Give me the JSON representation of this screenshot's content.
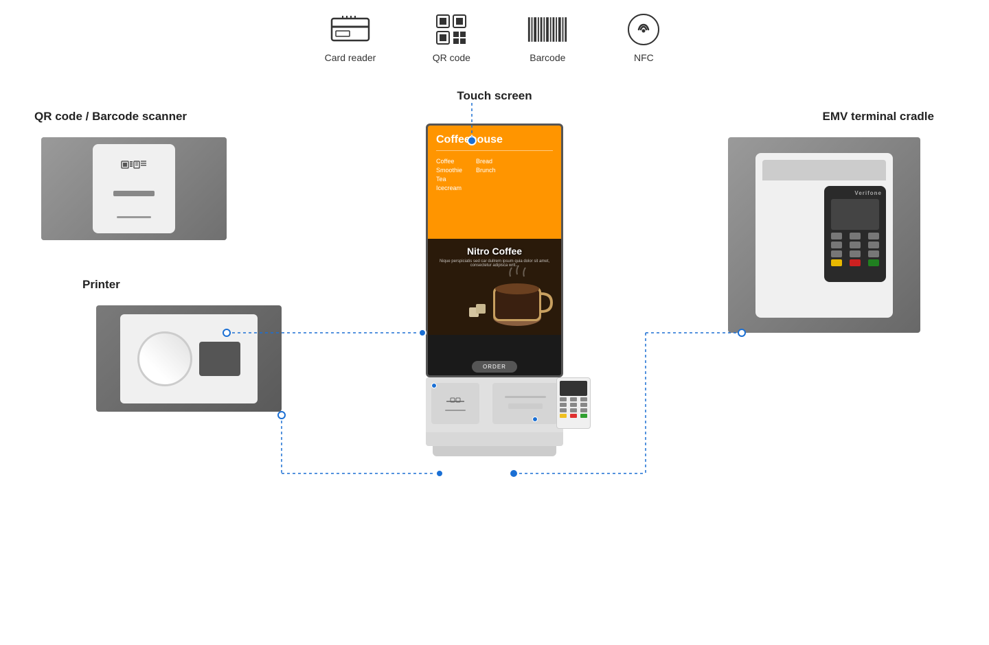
{
  "topIcons": {
    "items": [
      {
        "id": "card-reader",
        "label": "Card reader",
        "icon": "card-reader-icon"
      },
      {
        "id": "qr-code",
        "label": "QR code",
        "icon": "qr-code-icon"
      },
      {
        "id": "barcode",
        "label": "Barcode",
        "icon": "barcode-icon"
      },
      {
        "id": "nfc",
        "label": "NFC",
        "icon": "nfc-icon"
      }
    ]
  },
  "labels": {
    "touchScreen": "Touch screen",
    "qrBarcodeScanner": "QR code / Barcode scanner",
    "printer": "Printer",
    "emvTerminal": "EMV terminal cradle"
  },
  "screen": {
    "appName": "Coffeehouse",
    "menuItems": [
      {
        "left": [
          "Coffee",
          "Smoothie",
          "Tea",
          "Icecream"
        ]
      },
      {
        "right": [
          "Bread",
          "Brunch"
        ]
      }
    ],
    "productName": "Nitro Coffee",
    "productDesc": "Nique perspiciatis sed car dullrem ipsum quia dolor sit amet, consectetur adipisca writ...",
    "orderButton": "ORDER"
  },
  "colors": {
    "accent": "#ff9500",
    "dotBlue": "#1a6fd4",
    "dashedLine": "#1a6fd4",
    "screenBg": "#222222",
    "panelBg": "#888888"
  }
}
